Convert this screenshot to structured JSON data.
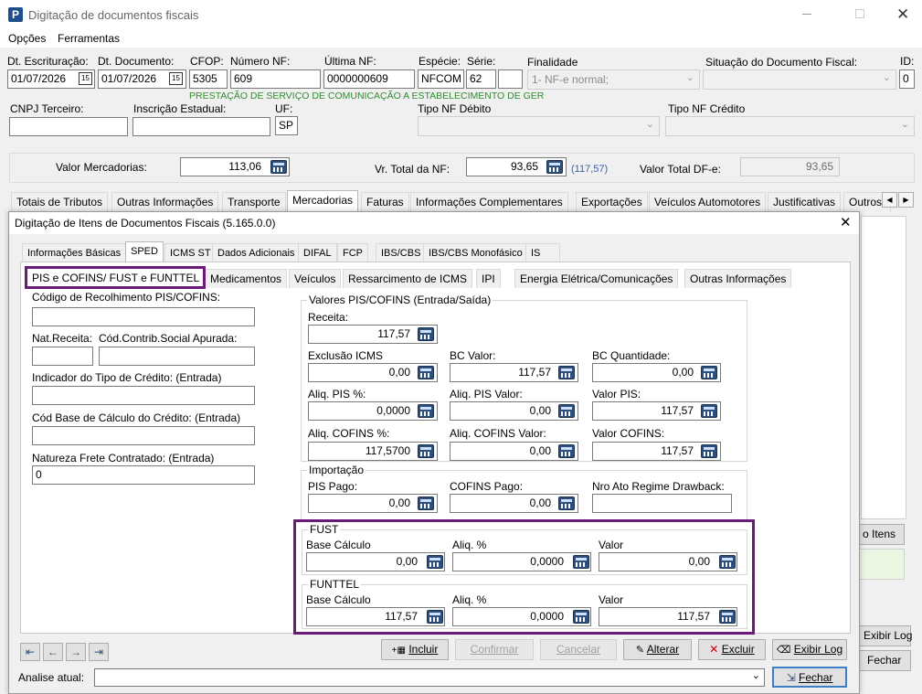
{
  "app": {
    "title": "Digitação de documentos fiscais",
    "menu": [
      "Opções",
      "Ferramentas"
    ]
  },
  "header": {
    "dt_escrituracao_label": "Dt. Escrituração:",
    "dt_escrituracao": "01/07/2026",
    "dt_documento_label": "Dt. Documento:",
    "dt_documento": "01/07/2026",
    "cfop_label": "CFOP:",
    "cfop": "5305",
    "numero_nf_label": "Número NF:",
    "numero_nf": "609",
    "ultima_nf_label": "Última NF:",
    "ultima_nf": "0000000609",
    "especie_label": "Espécie:",
    "especie": "NFCOM",
    "serie_label": "Série:",
    "serie": "62",
    "serie2": "",
    "finalidade_label": "Finalidade",
    "finalidade": "1- NF-e normal;",
    "situacao_label": "Situação do Documento Fiscal:",
    "situacao": "",
    "id_label": "ID:",
    "id": "0",
    "cfop_desc": "PRESTAÇÃO DE SERVIÇO DE COMUNICAÇÃO A ESTABELECIMENTO DE GER",
    "cnpj_label": "CNPJ Terceiro:",
    "cnpj": "",
    "ie_label": "Inscrição Estadual:",
    "ie": "",
    "uf_label": "UF:",
    "uf": "SP",
    "tipo_debito_label": "Tipo NF Débito",
    "tipo_credito_label": "Tipo NF Crédito"
  },
  "totals": {
    "valor_mercadorias_label": "Valor Mercadorias:",
    "valor_mercadorias": "113,06",
    "vr_total_nf_label": "Vr. Total da NF:",
    "vr_total_nf": "93,65",
    "vr_total_nf_hint": "(117,57)",
    "valor_total_df_label": "Valor Total DF-e:",
    "valor_total_df": "93,65"
  },
  "main_tabs": [
    "Totais de Tributos",
    "Outras Informações",
    "Transporte",
    "Mercadorias",
    "Faturas",
    "Informações Complementares",
    "Exportações",
    "Veículos Automotores",
    "Justificativas",
    "Outros"
  ],
  "bg_buttons": {
    "itens": "o Itens",
    "exibir_log": "Exibir Log",
    "fechar": "Fechar"
  },
  "dialog": {
    "title": "Digitação de Itens de Documentos Fiscais (5.165.0.0)",
    "tabs": [
      "Informações Básicas",
      "SPED",
      "ICMS ST",
      "Dados Adicionais",
      "DIFAL",
      "FCP",
      "IBS/CBS",
      "IBS/CBS Monofásico",
      "IS"
    ],
    "subtabs": [
      "PIS e COFINS/ FUST e FUNTTEL",
      "Medicamentos",
      "Veículos",
      "Ressarcimento de ICMS",
      "IPI",
      "Energia Elétrica/Comunicações",
      "Outras Informações"
    ],
    "left": {
      "cod_recolhimento_label": "Código de Recolhimento PIS/COFINS:",
      "cod_recolhimento": "",
      "nat_receita_label": "Nat.Receita:",
      "nat_receita": "",
      "cod_contrib_label": "Cód.Contrib.Social Apurada:",
      "cod_contrib": "",
      "indicador_label": "Indicador do Tipo de Crédito: (Entrada)",
      "indicador": "",
      "cod_base_label": "Cód Base de Cálculo do Crédito: (Entrada)",
      "cod_base": "",
      "natureza_frete_label": "Natureza Frete Contratado: (Entrada)",
      "natureza_frete": "0"
    },
    "pis_cofins": {
      "group_title": "Valores PIS/COFINS (Entrada/Saída)",
      "receita_label": "Receita:",
      "receita": "117,57",
      "exclusao_icms_label": "Exclusão ICMS",
      "exclusao_icms": "0,00",
      "bc_valor_label": "BC Valor:",
      "bc_valor": "117,57",
      "bc_quantidade_label": "BC Quantidade:",
      "bc_quantidade": "0,00",
      "aliq_pis_label": "Aliq. PIS %:",
      "aliq_pis": "0,0000",
      "aliq_pis_valor_label": "Aliq. PIS Valor:",
      "aliq_pis_valor": "0,00",
      "valor_pis_label": "Valor PIS:",
      "valor_pis": "117,57",
      "aliq_cofins_label": "Aliq. COFINS %:",
      "aliq_cofins": "117,5700",
      "aliq_cofins_valor_label": "Aliq. COFINS Valor:",
      "aliq_cofins_valor": "0,00",
      "valor_cofins_label": "Valor COFINS:",
      "valor_cofins": "117,57"
    },
    "importacao": {
      "group_title": "Importação",
      "pis_pago_label": "PIS Pago:",
      "pis_pago": "0,00",
      "cofins_pago_label": "COFINS Pago:",
      "cofins_pago": "0,00",
      "drawback_label": "Nro Ato Regime Drawback:",
      "drawback": ""
    },
    "fust": {
      "group_title": "FUST",
      "base_label": "Base Cálculo",
      "base": "0,00",
      "aliq_label": "Aliq. %",
      "aliq": "0,0000",
      "valor_label": "Valor",
      "valor": "0,00"
    },
    "funttel": {
      "group_title": "FUNTTEL",
      "base_label": "Base Cálculo",
      "base": "117,57",
      "aliq_label": "Aliq. %",
      "aliq": "0,0000",
      "valor_label": "Valor",
      "valor": "117,57"
    },
    "buttons": {
      "incluir": "Incluir",
      "confirmar": "Confirmar",
      "cancelar": "Cancelar",
      "alterar": "Alterar",
      "excluir": "Excluir",
      "exibir_log": "Exibir Log",
      "fechar": "Fechar"
    },
    "analise_label": "Analise atual:",
    "analise": ""
  },
  "colors": {
    "highlight": "#6a1b7a",
    "cfop_desc": "#2e8b2e",
    "hint": "#3a5fa0"
  }
}
